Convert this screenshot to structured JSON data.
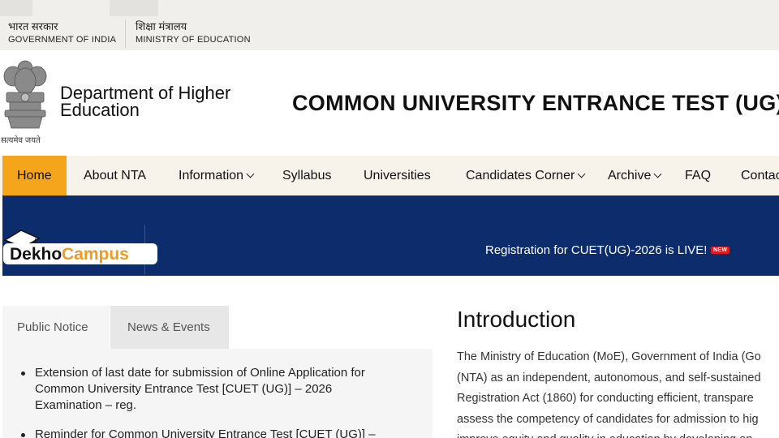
{
  "gov_bar": {
    "left": {
      "hindi": "भारत सरकार",
      "english": "GOVERNMENT OF INDIA"
    },
    "right": {
      "hindi": "शिक्षा मंत्रालय",
      "english": "MINISTRY OF EDUCATION"
    }
  },
  "header": {
    "emblem_motto": "सत्यमेव जयते",
    "department": [
      "Department of Higher",
      "Education"
    ],
    "site_title": "COMMON UNIVERSITY ENTRANCE TEST (UG)"
  },
  "nav": {
    "items": [
      {
        "label": "Home",
        "active": true
      },
      {
        "label": "About NTA"
      },
      {
        "label": "Information",
        "dropdown": true
      },
      {
        "label": "Syllabus"
      },
      {
        "label": "Universities"
      },
      {
        "label": "Candidates Corner",
        "dropdown": true
      },
      {
        "label": "Archive",
        "dropdown": true
      },
      {
        "label": "FAQ"
      },
      {
        "label": "Contac"
      }
    ],
    "active_color": "#f4a51c"
  },
  "banner": {
    "logo_text_dekho": "Dekho",
    "logo_text_campus": "Campus",
    "announcement": "Registration for CUET(UG)-2026 is LIVE!",
    "badge": "NEW",
    "background": "#0d2c6b"
  },
  "tabs": [
    {
      "label": "Public Notice",
      "active": true
    },
    {
      "label": "News & Events",
      "active": false
    }
  ],
  "notices": [
    [
      "Extension of last date for submission of Online Application for",
      "Common University Entrance Test [CUET (UG)] – 2026",
      "Examination – reg."
    ],
    [
      "Reminder for Common University Entrance Test [CUET (UG)] –"
    ]
  ],
  "intro": {
    "title": "Introduction",
    "lines": [
      "The Ministry of Education (MoE), Government of India (Go",
      "(NTA) as an independent, autonomous, and self-sustained",
      "Registration Act (1860) for conducting efficient, transpare",
      "assess the competency of candidates for admission to hig",
      "improve equity and quality in education by developing an"
    ]
  }
}
